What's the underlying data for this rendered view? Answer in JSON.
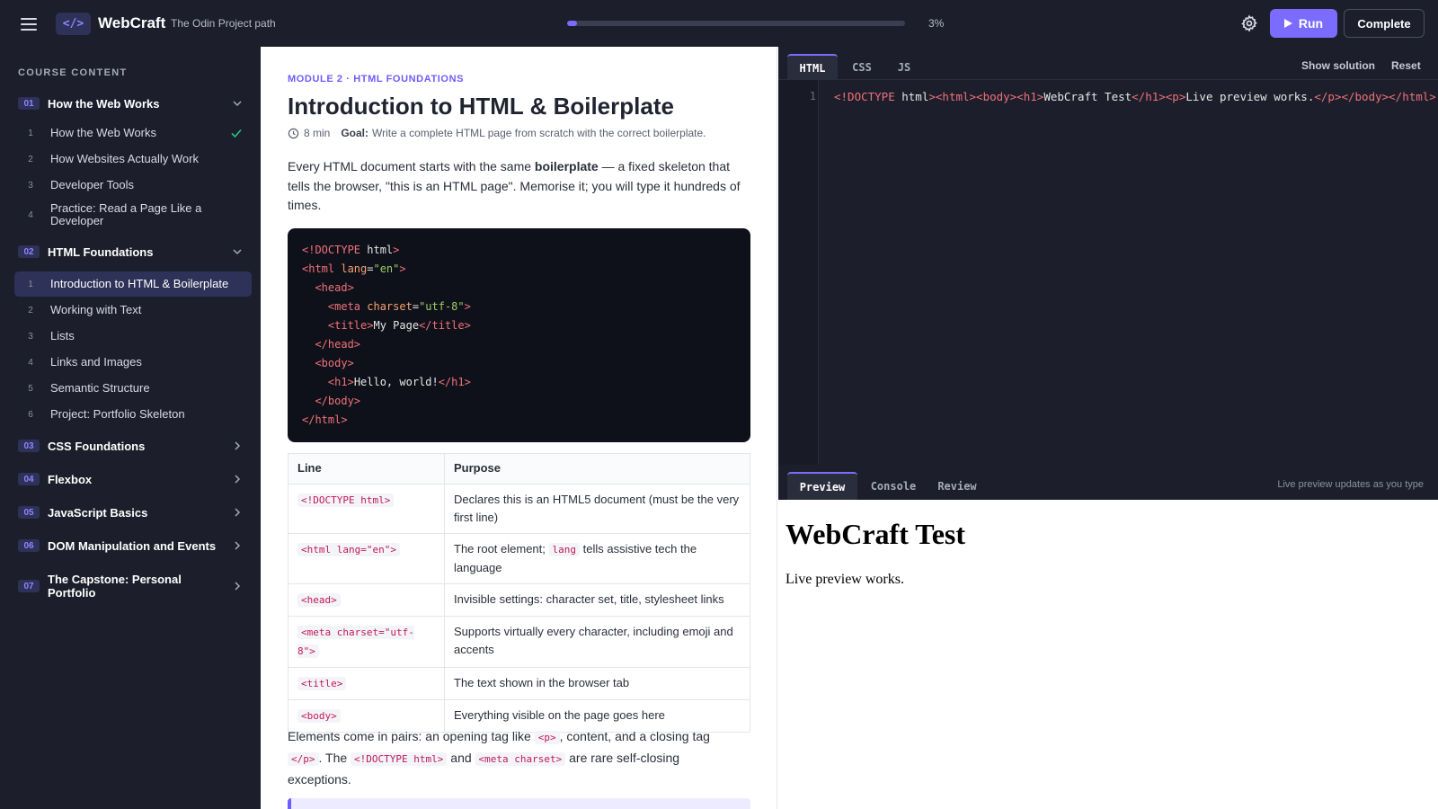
{
  "header": {
    "logo_glyph": "</>",
    "brand": "WebCraft",
    "subtitle": "The Odin Project path",
    "progress_percent": 3,
    "progress_label": "3%",
    "run_label": "Run",
    "complete_label": "Complete",
    "accent": "#7b6cff"
  },
  "sidebar": {
    "heading": "COURSE CONTENT",
    "modules": [
      {
        "num": "01",
        "title": "How the Web Works",
        "expanded": true,
        "lessons": [
          {
            "num": "1",
            "title": "How the Web Works",
            "done": true
          },
          {
            "num": "2",
            "title": "How Websites Actually Work"
          },
          {
            "num": "3",
            "title": "Developer Tools"
          },
          {
            "num": "4",
            "title": "Practice: Read a Page Like a Developer"
          }
        ]
      },
      {
        "num": "02",
        "title": "HTML Foundations",
        "expanded": true,
        "lessons": [
          {
            "num": "1",
            "title": "Introduction to HTML & Boilerplate",
            "active": true
          },
          {
            "num": "2",
            "title": "Working with Text"
          },
          {
            "num": "3",
            "title": "Lists"
          },
          {
            "num": "4",
            "title": "Links and Images"
          },
          {
            "num": "5",
            "title": "Semantic Structure"
          },
          {
            "num": "6",
            "title": "Project: Portfolio Skeleton"
          }
        ]
      },
      {
        "num": "03",
        "title": "CSS Foundations"
      },
      {
        "num": "04",
        "title": "Flexbox"
      },
      {
        "num": "05",
        "title": "JavaScript Basics"
      },
      {
        "num": "06",
        "title": "DOM Manipulation and Events"
      },
      {
        "num": "07",
        "title": "The Capstone: Personal Portfolio"
      }
    ]
  },
  "lesson": {
    "eyebrow": "MODULE 2 · HTML FOUNDATIONS",
    "title": "Introduction to HTML & Boilerplate",
    "duration": "8 min",
    "goal_label": "Goal:",
    "goal_text": "Write a complete HTML page from scratch with the correct boilerplate.",
    "intro_before": "Every HTML document starts with the same ",
    "intro_bold": "boilerplate",
    "intro_after": " — a fixed skeleton that tells the browser, \"this is an HTML page\". Memorise it; you will type it hundreds of times.",
    "code": {
      "l1": "<!DOCTYPE",
      "l1b": " html",
      "l1c": ">",
      "lang_attr": " lang",
      "lang_val": "\"en\"",
      "meta_attr": " charset",
      "meta_val": "\"utf-8\"",
      "title_text": "My Page",
      "h1_text": "Hello, world!"
    },
    "table": {
      "headers": [
        "Line",
        "Purpose"
      ],
      "rows": [
        {
          "code": "<!DOCTYPE html>",
          "purpose": "Declares this is an HTML5 document (must be the very first line)"
        },
        {
          "code": "<html lang=\"en\">",
          "purpose_before": "The root element; ",
          "purpose_code": "lang",
          "purpose_after": " tells assistive tech the language"
        },
        {
          "code": "<head>",
          "purpose": "Invisible settings: character set, title, stylesheet links"
        },
        {
          "code": "<meta charset=\"utf-8\">",
          "purpose": "Supports virtually every character, including emoji and accents"
        },
        {
          "code": "<title>",
          "purpose": "The text shown in the browser tab"
        },
        {
          "code": "<body>",
          "purpose": "Everything visible on the page goes here"
        }
      ]
    },
    "outro": {
      "t1": "Elements come in pairs: an opening tag like ",
      "c1": "<p>",
      "t2": ", content, and a closing tag ",
      "c2": "</p>",
      "t3": ". The ",
      "c3": "<!DOCTYPE html>",
      "t4": " and ",
      "c4": "<meta charset>",
      "t5": " are rare self-closing exceptions."
    }
  },
  "editor": {
    "tabs": [
      "HTML",
      "CSS",
      "JS"
    ],
    "active_tab": "HTML",
    "show_solution": "Show solution",
    "reset": "Reset",
    "line_number": "1",
    "code": {
      "doctype": "<!DOCTYPE",
      "doctype_rest": " html",
      "tags_open": "><html><body><h1>",
      "h1_text": "WebCraft Test",
      "mid": "</h1><p>",
      "p_text": "Live preview works.",
      "tags_close": "</p></body></html>"
    }
  },
  "preview": {
    "tabs": [
      "Preview",
      "Console",
      "Review"
    ],
    "active_tab": "Preview",
    "hint": "Live preview updates as you type",
    "h1": "WebCraft Test",
    "p": "Live preview works."
  }
}
